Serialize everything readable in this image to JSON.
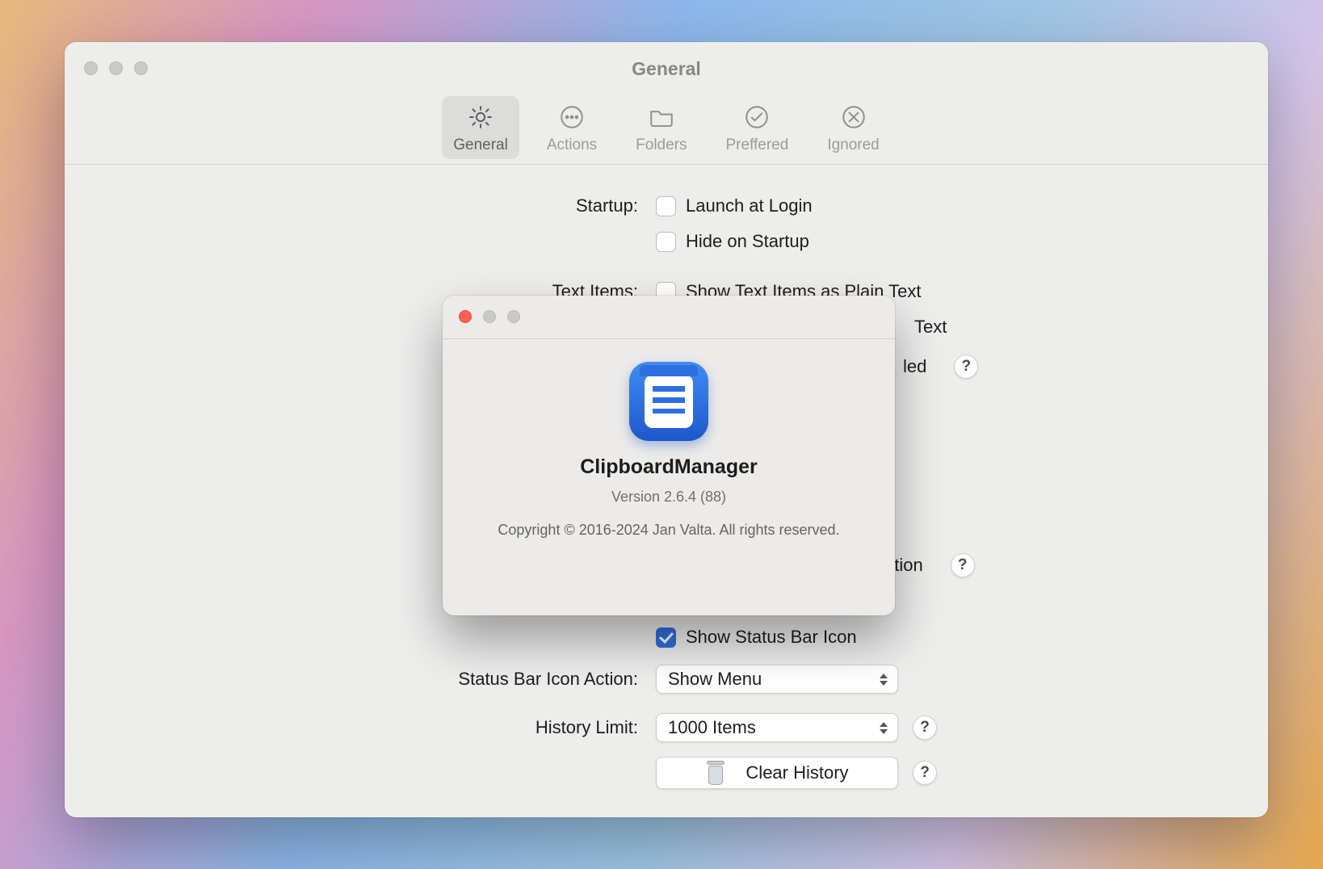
{
  "prefs": {
    "title": "General",
    "tabs": [
      {
        "label": "General"
      },
      {
        "label": "Actions"
      },
      {
        "label": "Folders"
      },
      {
        "label": "Preffered"
      },
      {
        "label": "Ignored"
      }
    ],
    "labels": {
      "startup": "Startup:",
      "textItems": "Text Items:",
      "statusBarAction": "Status Bar Icon Action:",
      "historyLimit": "History Limit:"
    },
    "options": {
      "launchAtLogin": "Launch at Login",
      "hideOnStartup": "Hide on Startup",
      "showPlainText": "Show Text Items as Plain Text",
      "trailingText": "Text",
      "trailingLed": "led",
      "trailingVation": "vation",
      "showStatusBarIcon": "Show Status Bar Icon"
    },
    "statusBarActionValue": "Show Menu",
    "historyLimitValue": "1000 Items",
    "clearHistory": "Clear History",
    "help": "?"
  },
  "about": {
    "appName": "ClipboardManager",
    "version": "Version 2.6.4 (88)",
    "copyright": "Copyright © 2016-2024 Jan Valta. All rights reserved."
  }
}
